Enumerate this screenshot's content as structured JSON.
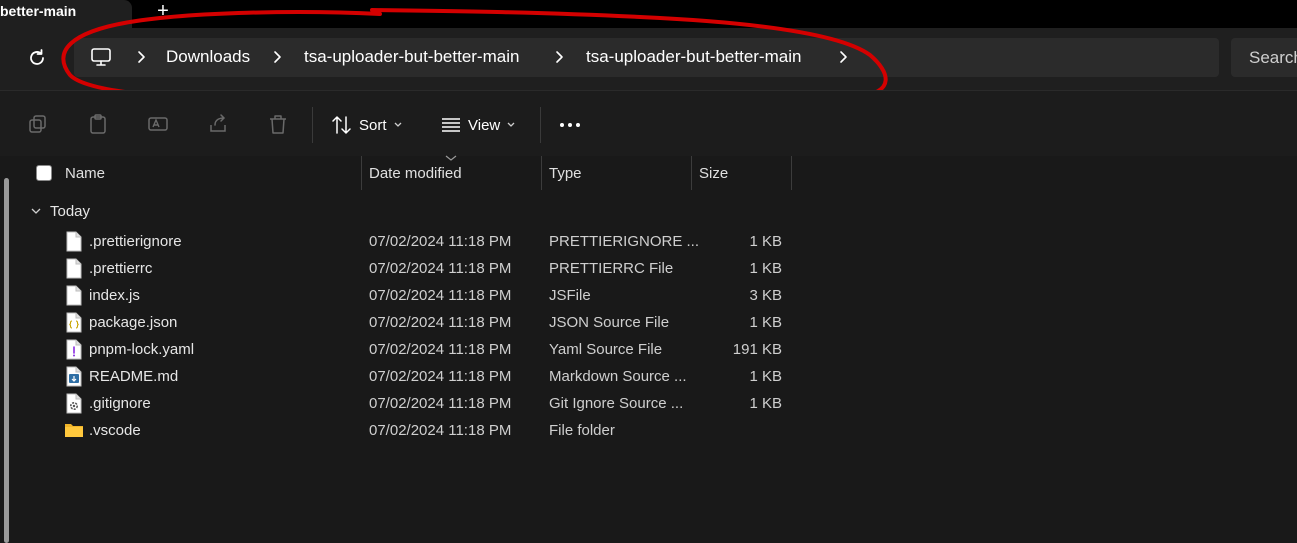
{
  "tab": {
    "title": "better-main",
    "new_tab_symbol": "+"
  },
  "address": {
    "refresh_icon": "refresh-icon",
    "root_icon": "this-pc-icon",
    "crumbs": [
      "Downloads",
      "tsa-uploader-but-better-main",
      "tsa-uploader-but-better-main"
    ]
  },
  "search": {
    "placeholder": "Search"
  },
  "annotation": {
    "color": "#d40000"
  },
  "commands": {
    "sort_label": "Sort",
    "view_label": "View",
    "icons": [
      "copy-icon",
      "paste-icon",
      "rename-icon",
      "share-icon",
      "delete-icon",
      "more-icon"
    ]
  },
  "columns": {
    "name": "Name",
    "date": "Date modified",
    "type": "Type",
    "size": "Size"
  },
  "group": {
    "label": "Today"
  },
  "files": [
    {
      "name": ".prettierignore",
      "date": "07/02/2024 11:18 PM",
      "type": "PRETTIERIGNORE ...",
      "size": "1 KB",
      "icon": "blank-file-icon"
    },
    {
      "name": ".prettierrc",
      "date": "07/02/2024 11:18 PM",
      "type": "PRETTIERRC File",
      "size": "1 KB",
      "icon": "blank-file-icon"
    },
    {
      "name": "index.js",
      "date": "07/02/2024 11:18 PM",
      "type": "JSFile",
      "size": "3 KB",
      "icon": "blank-file-icon"
    },
    {
      "name": "package.json",
      "date": "07/02/2024 11:18 PM",
      "type": "JSON Source File",
      "size": "1 KB",
      "icon": "json-file-icon"
    },
    {
      "name": "pnpm-lock.yaml",
      "date": "07/02/2024 11:18 PM",
      "type": "Yaml Source File",
      "size": "191 KB",
      "icon": "yaml-file-icon"
    },
    {
      "name": "README.md",
      "date": "07/02/2024 11:18 PM",
      "type": "Markdown Source ...",
      "size": "1 KB",
      "icon": "markdown-file-icon"
    },
    {
      "name": ".gitignore",
      "date": "07/02/2024 11:18 PM",
      "type": "Git Ignore Source ...",
      "size": "1 KB",
      "icon": "config-file-icon"
    },
    {
      "name": ".vscode",
      "date": "07/02/2024 11:18 PM",
      "type": "File folder",
      "size": "",
      "icon": "folder-icon"
    }
  ]
}
